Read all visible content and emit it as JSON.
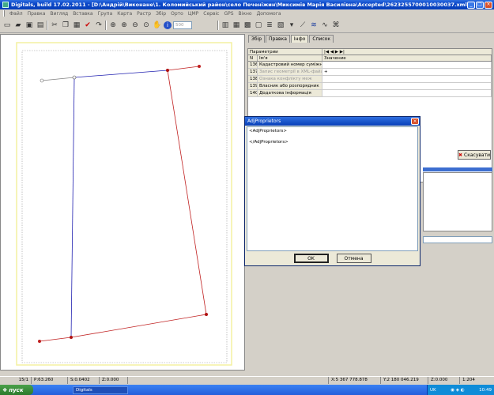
{
  "window": {
    "title": "Digitals, build 17.02.2011 - [D:\\Андрій\\Виконане\\1. Коломийський район\\село Печеніжин\\Миксимів Марія Василівна\\Accepted\\2623255700010030037.xml]",
    "minimize": "_",
    "maximize": "□",
    "close": "×"
  },
  "menu": [
    "Файл",
    "Правка",
    "Вигляд",
    "Вставка",
    "Група",
    "Карта",
    "Растр",
    "Збір",
    "Орто",
    "ЦМР",
    "Сервіс",
    "GPS",
    "Вікно",
    "Допомога"
  ],
  "toolbar": {
    "scale_value": "500"
  },
  "right_panel": {
    "tabs": [
      "Збір",
      "Правка",
      "Інфо",
      "Список"
    ],
    "active_tab": "Інфо",
    "grid_header_params": "Параметрии",
    "columns": [
      "N",
      "Ім'я",
      "Значение"
    ],
    "rows": [
      {
        "n": "136",
        "name": "Кадастровий номер суміжної ка",
        "value": "",
        "dim": false
      },
      {
        "n": "137",
        "name": "Запис геометрії в XML-файл",
        "value": "+",
        "dim": true
      },
      {
        "n": "138",
        "name": "Ознака конфлікту меж",
        "value": "",
        "dim": true
      },
      {
        "n": "139",
        "name": "Власник або розпорядник",
        "value": "",
        "dim": false
      },
      {
        "n": "140",
        "name": "Додаткова інформація",
        "value": "",
        "dim": false
      }
    ],
    "cancel_label": "Скасувати"
  },
  "dialog": {
    "title": "AdjProprietors",
    "line1": "<AdjProprietors>",
    "line2": "</AdjProprietors>",
    "ok_label": "OK",
    "cancel_label": "Отмена"
  },
  "status": {
    "page": "15/1",
    "p_value": "P:63.260",
    "s_value": "S:0.0402",
    "z_value": "Z:0.000",
    "x_coord": "X:5 367 778.878",
    "y_coord": "Y:2 180 046.219",
    "z2_value": "Z:0.000",
    "scale": "1:204"
  },
  "taskbar": {
    "start_label": "пуск",
    "task_label": "Digitals",
    "lang": "UK",
    "time": "10:49"
  },
  "colors": {
    "parcel_red": "#c02020",
    "parcel_blue": "#2020b0",
    "neighbor_gray": "#808080"
  }
}
